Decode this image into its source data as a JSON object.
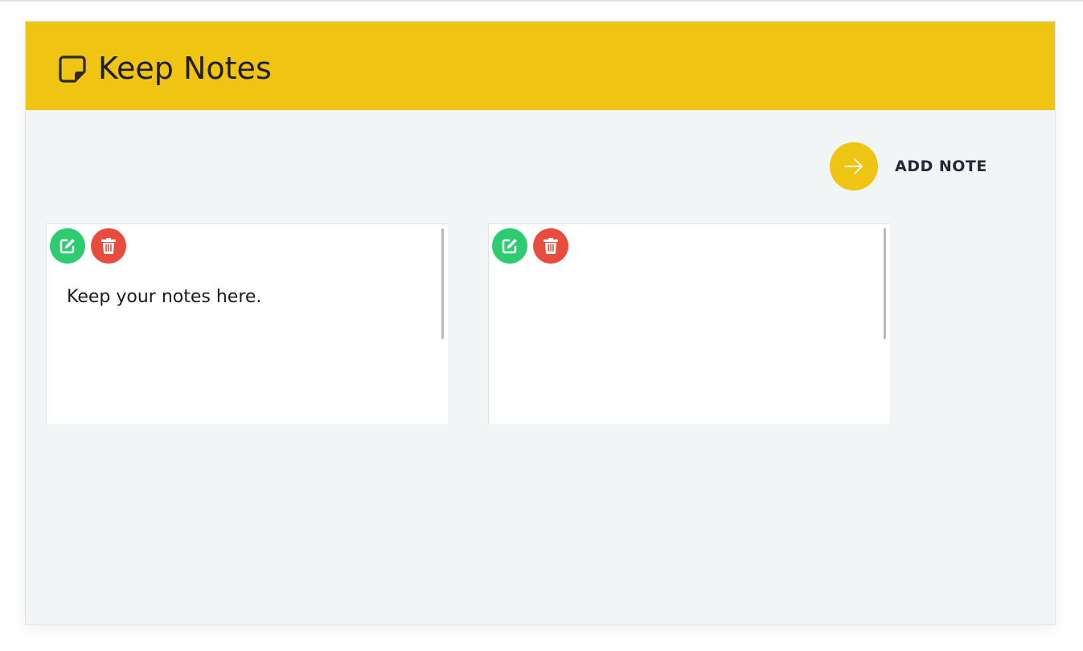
{
  "header": {
    "title": "Keep Notes",
    "logo_icon": "sticky-note-icon",
    "background": "#f0c412"
  },
  "toolbar": {
    "add_note_label": "ADD NOTE",
    "add_note_icon": "arrow-right-icon"
  },
  "notes": [
    {
      "text": "Keep your notes here.",
      "edit_icon": "edit-icon",
      "delete_icon": "trash-icon"
    },
    {
      "text": "",
      "edit_icon": "edit-icon",
      "delete_icon": "trash-icon"
    }
  ],
  "colors": {
    "accent": "#f0c412",
    "edit": "#2ecc71",
    "delete": "#e74c3c",
    "app_background": "#f2f5f6"
  }
}
